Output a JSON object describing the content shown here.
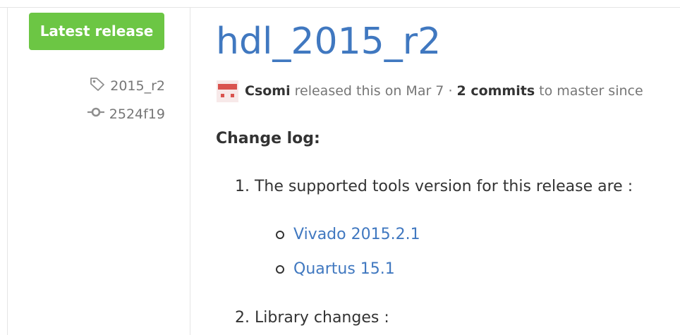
{
  "sidebar": {
    "latest_release_label": "Latest release",
    "tag": "2015_r2",
    "commit": "2524f19",
    "tag_icon": "tag-icon",
    "commit_icon": "git-commit-icon"
  },
  "release": {
    "title": "hdl_2015_r2",
    "author": "Csomi",
    "released_text": "released this on Mar 7 ·",
    "commits_link": "2 commits",
    "commits_suffix": "to master since"
  },
  "notes": {
    "heading": "Change log:",
    "items": [
      {
        "label": "1. The supported tools version for this release are :",
        "sub": [
          "Vivado 2015.2.1",
          "Quartus 15.1"
        ]
      },
      {
        "label": "2. Library changes :"
      }
    ]
  },
  "colors": {
    "accent_green": "#6cc644",
    "link_blue": "#4078c0",
    "avatar_red": "#d9534f"
  }
}
